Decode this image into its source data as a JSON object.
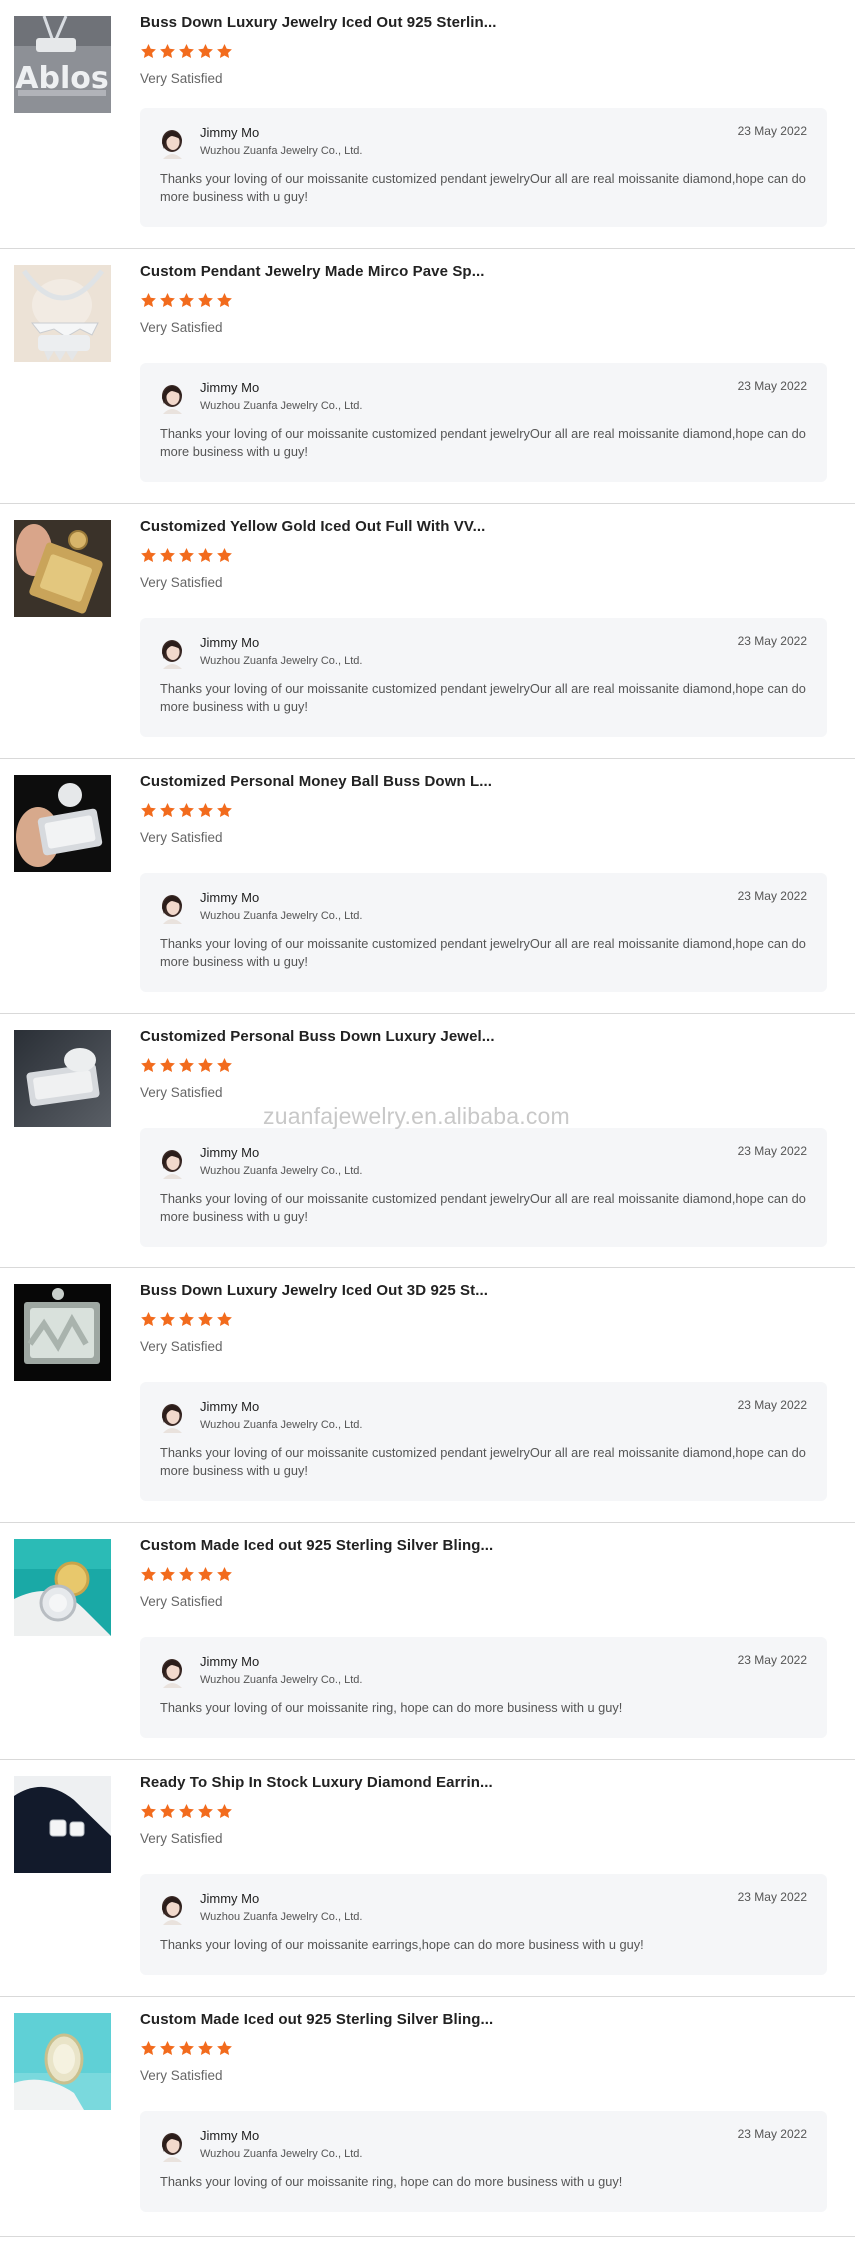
{
  "colors": {
    "star": "#f26b1d",
    "card_bg": "#f5f6f8",
    "divider": "#d9d9d9"
  },
  "rating_stars": 5,
  "watermark": "zuanfajewelry.en.alibaba.com",
  "reviews": [
    {
      "thumb_icon": "iced-out-name-pendant-thumbnail",
      "title": "Buss Down Luxury Jewelry Iced Out 925 Sterlin...",
      "rating": 5,
      "satisfaction": "Very Satisfied",
      "reply": {
        "seller": "Jimmy Mo",
        "company": "Wuzhou Zuanfa Jewelry Co., Ltd.",
        "date": "23 May 2022",
        "text": "Thanks your loving of our moissanite customized pendant jewelryOur all are real moissanite diamond,hope can do more business with u guy!"
      }
    },
    {
      "thumb_icon": "pave-pendant-necklace-thumbnail",
      "title": "Custom Pendant Jewelry Made Mirco Pave Sp...",
      "rating": 5,
      "satisfaction": "Very Satisfied",
      "reply": {
        "seller": "Jimmy Mo",
        "company": "Wuzhou Zuanfa Jewelry Co., Ltd.",
        "date": "23 May 2022",
        "text": "Thanks your loving of our moissanite customized pendant jewelryOur all are real moissanite diamond,hope can do more business with u guy!"
      }
    },
    {
      "thumb_icon": "yellow-gold-pendant-thumbnail",
      "title": "Customized Yellow Gold Iced Out Full With VV...",
      "rating": 5,
      "satisfaction": "Very Satisfied",
      "reply": {
        "seller": "Jimmy Mo",
        "company": "Wuzhou Zuanfa Jewelry Co., Ltd.",
        "date": "23 May 2022",
        "text": "Thanks your loving of our moissanite customized pendant jewelryOur all are real moissanite diamond,hope can do more business with u guy!"
      }
    },
    {
      "thumb_icon": "money-ball-pendant-thumbnail",
      "title": "Customized Personal Money Ball Buss Down L...",
      "rating": 5,
      "satisfaction": "Very Satisfied",
      "reply": {
        "seller": "Jimmy Mo",
        "company": "Wuzhou Zuanfa Jewelry Co., Ltd.",
        "date": "23 May 2022",
        "text": "Thanks your loving of our moissanite customized pendant jewelryOur all are real moissanite diamond,hope can do more business with u guy!"
      }
    },
    {
      "thumb_icon": "buss-down-pendant-thumbnail",
      "title": "Customized Personal Buss Down Luxury Jewel...",
      "rating": 5,
      "satisfaction": "Very Satisfied",
      "reply": {
        "seller": "Jimmy Mo",
        "company": "Wuzhou Zuanfa Jewelry Co., Ltd.",
        "date": "23 May 2022",
        "text": "Thanks your loving of our moissanite customized pendant jewelryOur all are real moissanite diamond,hope can do more business with u guy!"
      }
    },
    {
      "thumb_icon": "3d-iced-pendant-thumbnail",
      "title": "Buss Down Luxury Jewelry Iced Out 3D 925 St...",
      "rating": 5,
      "satisfaction": "Very Satisfied",
      "reply": {
        "seller": "Jimmy Mo",
        "company": "Wuzhou Zuanfa Jewelry Co., Ltd.",
        "date": "23 May 2022",
        "text": "Thanks your loving of our moissanite customized pendant jewelryOur all are real moissanite diamond,hope can do more business with u guy!"
      }
    },
    {
      "thumb_icon": "silver-ring-thumbnail",
      "title": "Custom Made Iced out 925 Sterling Silver Bling...",
      "rating": 5,
      "satisfaction": "Very Satisfied",
      "reply": {
        "seller": "Jimmy Mo",
        "company": "Wuzhou Zuanfa Jewelry Co., Ltd.",
        "date": "23 May 2022",
        "text": "Thanks your loving of our moissanite ring, hope can do more business with u guy!"
      }
    },
    {
      "thumb_icon": "diamond-earrings-thumbnail",
      "title": "Ready To Ship In Stock Luxury Diamond Earrin...",
      "rating": 5,
      "satisfaction": "Very Satisfied",
      "reply": {
        "seller": "Jimmy Mo",
        "company": "Wuzhou Zuanfa Jewelry Co., Ltd.",
        "date": "23 May 2022",
        "text": "Thanks your loving of our moissanite earrings,hope can do more business with u guy!"
      }
    },
    {
      "thumb_icon": "iced-ring-thumbnail",
      "title": "Custom Made Iced out 925 Sterling Silver Bling...",
      "rating": 5,
      "satisfaction": "Very Satisfied",
      "reply": {
        "seller": "Jimmy Mo",
        "company": "Wuzhou Zuanfa Jewelry Co., Ltd.",
        "date": "23 May 2022",
        "text": "Thanks your loving of our moissanite ring, hope can do more business with u guy!"
      }
    }
  ]
}
